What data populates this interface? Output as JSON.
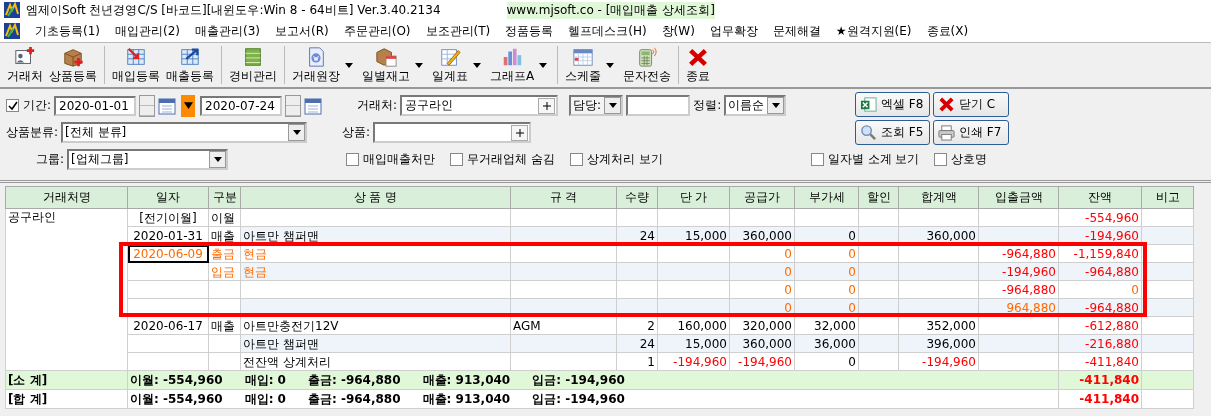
{
  "window": {
    "title": "엠제이Soft 천년경영C/S [바코드][내윈도우:Win 8 - 64비트] Ver.3.40.2134",
    "subtitle": "www.mjsoft.co - [매입매출 상세조회]"
  },
  "menu": [
    "기초등록(1)",
    "매입관리(2)",
    "매출관리(3)",
    "보고서(R)",
    "주문관리(O)",
    "보조관리(T)",
    "정품등록",
    "헬프데스크(H)",
    "창(W)",
    "업무확장",
    "문제해결",
    "★원격지원(E)",
    "종료(X)"
  ],
  "toolbar": [
    [
      {
        "label": "거래처",
        "dropdown": false
      },
      {
        "label": "상품등록",
        "dropdown": false
      }
    ],
    [
      {
        "label": "매입등록",
        "dropdown": false
      },
      {
        "label": "매출등록",
        "dropdown": false
      }
    ],
    [
      {
        "label": "경비관리",
        "dropdown": false
      }
    ],
    [
      {
        "label": "거래원장",
        "dropdown": true
      },
      {
        "label": "일별재고",
        "dropdown": true
      },
      {
        "label": "일계표",
        "dropdown": true
      },
      {
        "label": "그래프A",
        "dropdown": true
      }
    ],
    [
      {
        "label": "스케줄",
        "dropdown": true
      },
      {
        "label": "문자전송",
        "dropdown": false
      }
    ],
    [
      {
        "label": "종료",
        "dropdown": false
      }
    ]
  ],
  "filters": {
    "period": {
      "label": "기간:",
      "checked": true,
      "from": "2020-01-01",
      "to": "2020-07-24"
    },
    "client": {
      "label": "거래처:",
      "value": "공구라인"
    },
    "manager": {
      "label": "담당:"
    },
    "sort": {
      "label": "정렬:",
      "value": "이름순"
    },
    "category": {
      "label": "상품분류:",
      "value": "[전체 분류]"
    },
    "product": {
      "label": "상품:"
    },
    "group": {
      "label": "그룹:",
      "value": "[업체그룹]"
    },
    "options": [
      {
        "label": "매입매출처만",
        "checked": false
      },
      {
        "label": "무거래업체 숨김",
        "checked": false
      },
      {
        "label": "상계처리 보기",
        "checked": false
      },
      {
        "label": "일자별 소계 보기",
        "checked": false
      },
      {
        "label": "상호명",
        "checked": false
      }
    ]
  },
  "actions": [
    "엑셀 F8",
    "닫기 C",
    "조회 F5",
    "인쇄 F7"
  ],
  "table": {
    "columns": [
      "거래처명",
      "일자",
      "구분",
      "상 품 명",
      "규 격",
      "수량",
      "단 가",
      "공급가",
      "부가세",
      "할인",
      "합계액",
      "입출금액",
      "잔액",
      "비고"
    ],
    "customer": "공구라인",
    "rows": [
      {
        "kind": "entry",
        "date": "[전기이월]",
        "type": "이월",
        "balance": {
          "text": "-554,960",
          "red": true
        },
        "marked": false,
        "focused": false
      },
      {
        "kind": "entry",
        "date": "2020-01-31",
        "type": "매출",
        "product": "아트만 챔퍼맨",
        "qty": "24",
        "price": {
          "text": "15,000",
          "red": false
        },
        "supply": {
          "text": "360,000",
          "red": false
        },
        "vat": "0",
        "total": {
          "text": "360,000",
          "red": false
        },
        "balance": {
          "text": "-194,960",
          "red": true
        },
        "marked": false,
        "focused": false
      },
      {
        "kind": "payment",
        "date": "2020-06-09",
        "type": "출금",
        "product": "현금",
        "supply": {
          "text": "0",
          "red": false
        },
        "vat": "0",
        "amount": {
          "text": "-964,880",
          "red": true
        },
        "balance": {
          "text": "-1,159,840",
          "red": true
        },
        "marked": true,
        "focused": true
      },
      {
        "kind": "payment",
        "type": "입금",
        "product": "현금",
        "supply": {
          "text": "0",
          "red": false
        },
        "vat": "0",
        "amount": {
          "text": "-194,960",
          "red": true
        },
        "balance": {
          "text": "-964,880",
          "red": true
        },
        "marked": true,
        "focused": false
      },
      {
        "kind": "payment",
        "supply": {
          "text": "0",
          "red": false
        },
        "vat": "0",
        "amount": {
          "text": "-964,880",
          "red": true
        },
        "balance": {
          "text": "0",
          "red": false
        },
        "marked": true,
        "focused": false
      },
      {
        "kind": "payment",
        "supply": {
          "text": "0",
          "red": false
        },
        "vat": "0",
        "amount": {
          "text": "964,880",
          "red": false
        },
        "balance": {
          "text": "-964,880",
          "red": true
        },
        "marked": true,
        "focused": false
      },
      {
        "kind": "entry",
        "date": "2020-06-17",
        "type": "매출",
        "product": "아트만충전기12V",
        "spec": "AGM",
        "qty": "2",
        "price": {
          "text": "160,000",
          "red": false
        },
        "supply": {
          "text": "320,000",
          "red": false
        },
        "vat": "32,000",
        "total": {
          "text": "352,000",
          "red": false
        },
        "balance": {
          "text": "-612,880",
          "red": true
        },
        "marked": false,
        "focused": false
      },
      {
        "kind": "entry",
        "product": "아트만 챔퍼맨",
        "qty": "24",
        "price": {
          "text": "15,000",
          "red": false
        },
        "supply": {
          "text": "360,000",
          "red": false
        },
        "vat": "36,000",
        "total": {
          "text": "396,000",
          "red": false
        },
        "balance": {
          "text": "-216,880",
          "red": true
        },
        "marked": false,
        "focused": false
      },
      {
        "kind": "entry",
        "product": "전잔액 상계처리",
        "qty": "1",
        "price": {
          "text": "-194,960",
          "red": true
        },
        "supply": {
          "text": "-194,960",
          "red": true
        },
        "vat": "0",
        "total": {
          "text": "-194,960",
          "red": true
        },
        "balance": {
          "text": "-411,840",
          "red": true
        },
        "marked": false,
        "focused": false
      }
    ],
    "totals": [
      {
        "kind": "subtotal",
        "label": "[소 계]",
        "items": [
          "이월: -554,960",
          "매입: 0",
          "출금: -964,880",
          "매출: 913,040",
          "입금: -194,960"
        ],
        "balance": "-411,840"
      },
      {
        "kind": "total",
        "label": "[합 계]",
        "items": [
          "이월: -554,960",
          "매입: 0",
          "출금: -964,880",
          "매출: 913,040",
          "입금: -194,960"
        ],
        "balance": "-411,840"
      }
    ]
  }
}
